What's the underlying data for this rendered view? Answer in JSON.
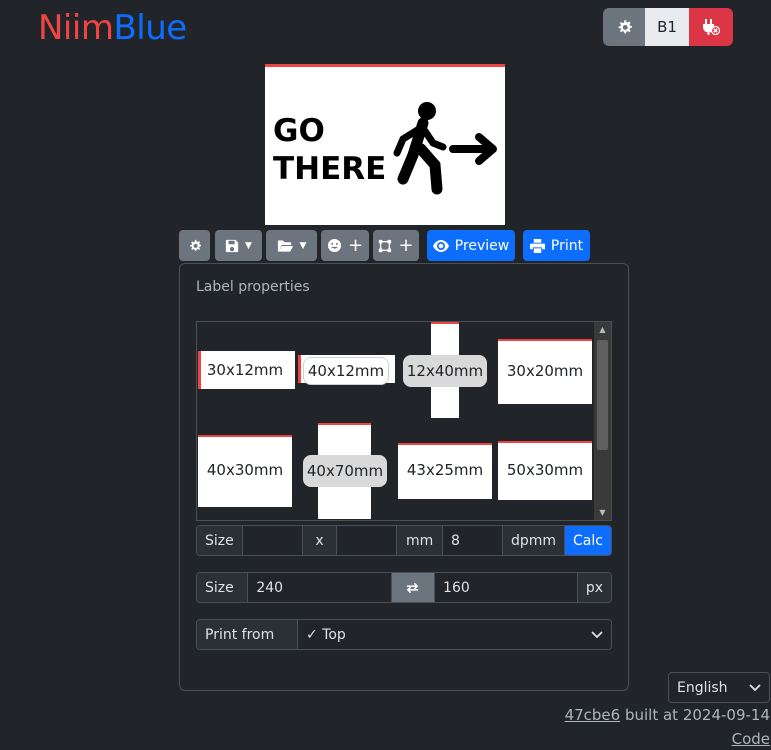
{
  "header": {
    "brand_a": "Niim",
    "brand_b": "Blue",
    "printer_model": "B1"
  },
  "canvas": {
    "line1": "GO",
    "line2": "THERE"
  },
  "toolbar": {
    "preview_label": "Preview",
    "print_label": "Print"
  },
  "panel": {
    "title": "Label properties",
    "templates": [
      "30x12mm",
      "40x12mm",
      "12x40mm",
      "30x20mm",
      "40x30mm",
      "40x70mm",
      "43x25mm",
      "50x30mm"
    ],
    "size_calc": {
      "size_label": "Size",
      "width_value": "",
      "x_label": "x",
      "height_value": "",
      "mm_label": "mm",
      "dpmm_value": "8",
      "dpmm_label": "dpmm",
      "calc_label": "Calc"
    },
    "size_px": {
      "size_label": "Size",
      "width_value": "240",
      "height_value": "160",
      "px_label": "px"
    },
    "print_from": {
      "label": "Print from",
      "value": "✓ Top"
    }
  },
  "language": {
    "value": "English"
  },
  "footer": {
    "commit": "47cbe6",
    "built_text": " built at 2024-09-14",
    "code_link": "Code"
  },
  "colors": {
    "accent_blue": "#0d6efd",
    "accent_red": "#dc3545",
    "brand_red": "#ef4444",
    "background": "#212529"
  }
}
